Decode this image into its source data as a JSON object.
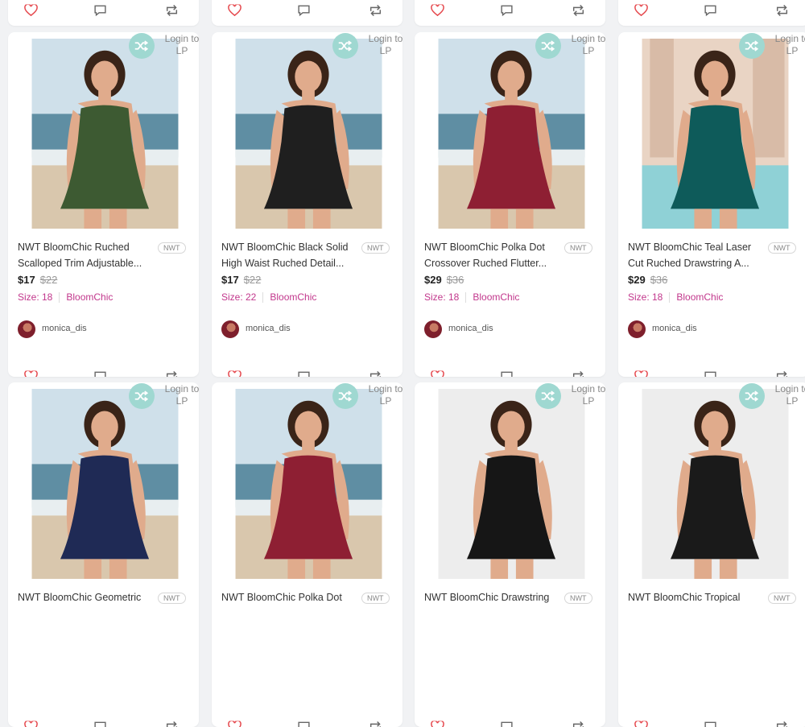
{
  "login_text": "Login to LP",
  "login_line1": "Login to",
  "login_line2": "LP",
  "colors": {
    "heart": "#e5484d",
    "accent_pink": "#c2378c",
    "shuffle_bg": "#9fd8d1"
  },
  "icons": {
    "like": "heart-icon",
    "comment": "comment-icon",
    "share": "repost-icon",
    "shuffle": "shuffle-icon"
  },
  "listings": [
    {
      "title_line1": "NWT BloomChic Ruched",
      "title_line2": "Scalloped Trim Adjustable...",
      "badge": "NWT",
      "price": "$17",
      "original_price": "$22",
      "size": "Size: 18",
      "brand": "BloomChic",
      "seller": "monica_dis",
      "garment_color": "#3d5a32",
      "background": "beach"
    },
    {
      "title_line1": "NWT BloomChic Black Solid",
      "title_line2": "High Waist Ruched Detail...",
      "badge": "NWT",
      "price": "$17",
      "original_price": "$22",
      "size": "Size: 22",
      "brand": "BloomChic",
      "seller": "monica_dis",
      "garment_color": "#1f1f1f",
      "background": "beach"
    },
    {
      "title_line1": "NWT BloomChic Polka Dot",
      "title_line2": "Crossover Ruched Flutter...",
      "badge": "NWT",
      "price": "$29",
      "original_price": "$36",
      "size": "Size: 18",
      "brand": "BloomChic",
      "seller": "monica_dis",
      "garment_color": "#8e1f33",
      "background": "beach"
    },
    {
      "title_line1": "NWT BloomChic Teal Laser",
      "title_line2": "Cut Ruched Drawstring A...",
      "badge": "NWT",
      "price": "$29",
      "original_price": "$36",
      "size": "Size: 18",
      "brand": "BloomChic",
      "seller": "monica_dis",
      "garment_color": "#0e5b5a",
      "background": "pool"
    },
    {
      "title_line1": "NWT BloomChic Geometric",
      "title_line2": "",
      "badge": "NWT",
      "garment_color": "#1f2a55",
      "background": "beach"
    },
    {
      "title_line1": "NWT BloomChic Polka Dot",
      "title_line2": "",
      "badge": "NWT",
      "garment_color": "#8e1f33",
      "background": "beach"
    },
    {
      "title_line1": "NWT BloomChic Drawstring",
      "title_line2": "",
      "badge": "NWT",
      "garment_color": "#161616",
      "background": "studio"
    },
    {
      "title_line1": "NWT BloomChic Tropical",
      "title_line2": "",
      "badge": "NWT",
      "garment_color": "#1a1a1a",
      "background": "studio"
    }
  ]
}
